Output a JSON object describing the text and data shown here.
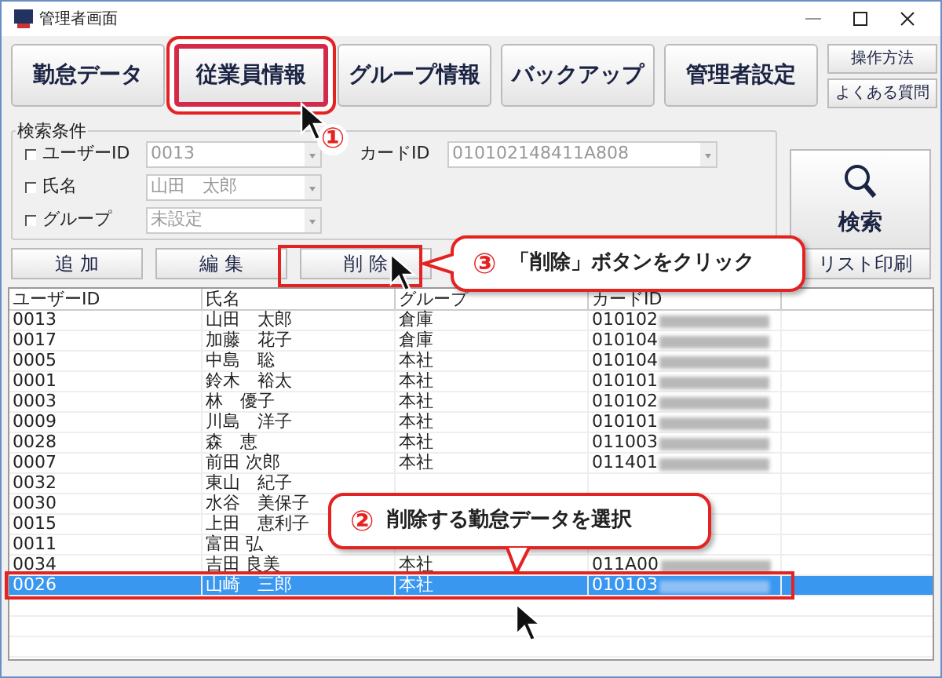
{
  "window": {
    "title": "管理者画面"
  },
  "tabs": [
    {
      "label": "勤怠データ",
      "selected": false
    },
    {
      "label": "従業員情報",
      "selected": true
    },
    {
      "label": "グループ情報",
      "selected": false
    },
    {
      "label": "バックアップ",
      "selected": false
    },
    {
      "label": "管理者設定",
      "selected": false
    }
  ],
  "help_buttons": [
    "操作方法",
    "よくある質問"
  ],
  "search": {
    "title": "検索条件",
    "button": "検索",
    "fields": [
      {
        "label": "ユーザーID",
        "checked": false,
        "value": "0013"
      },
      {
        "label": "氏名",
        "checked": false,
        "value": "山田　太郎"
      },
      {
        "label": "グループ",
        "checked": false,
        "value": "未設定"
      }
    ],
    "card_field": {
      "label": "カードID",
      "value": "010102148411A808"
    }
  },
  "actions": [
    "追 加",
    "編 集",
    "削 除",
    "リスト印刷"
  ],
  "table": {
    "columns": [
      "ユーザーID",
      "氏名",
      "グループ",
      "カードID"
    ],
    "rows": [
      {
        "cells": [
          "0013",
          "山田　太郎",
          "倉庫",
          "010102"
        ],
        "selected": false
      },
      {
        "cells": [
          "0017",
          "加藤　花子",
          "倉庫",
          "010104"
        ],
        "selected": false
      },
      {
        "cells": [
          "0005",
          "中島　聡",
          "本社",
          "010104"
        ],
        "selected": false
      },
      {
        "cells": [
          "0001",
          "鈴木　裕太",
          "本社",
          "010101"
        ],
        "selected": false
      },
      {
        "cells": [
          "0003",
          "林　優子",
          "本社",
          "010102"
        ],
        "selected": false
      },
      {
        "cells": [
          "0009",
          "川島　洋子",
          "本社",
          "010101"
        ],
        "selected": false
      },
      {
        "cells": [
          "0028",
          "森　恵",
          "本社",
          "011003"
        ],
        "selected": false
      },
      {
        "cells": [
          "0007",
          "前田 次郎",
          "本社",
          "011401"
        ],
        "selected": false
      },
      {
        "cells": [
          "0032",
          "東山　紀子",
          "",
          ""
        ],
        "selected": false
      },
      {
        "cells": [
          "0030",
          "水谷　美保子",
          "",
          ""
        ],
        "selected": false
      },
      {
        "cells": [
          "0015",
          "上田　恵利子",
          "",
          ""
        ],
        "selected": false
      },
      {
        "cells": [
          "0011",
          "富田 弘",
          "",
          ""
        ],
        "selected": false
      },
      {
        "cells": [
          "0034",
          "吉田 良美",
          "本社",
          "011A00"
        ],
        "selected": false
      },
      {
        "cells": [
          "0026",
          "山崎　三郎",
          "本社",
          "010103"
        ],
        "selected": true
      }
    ]
  },
  "callouts": [
    {
      "number": "①"
    },
    {
      "number": "③",
      "text": "「削除」ボタンをクリック"
    },
    {
      "number": "②",
      "text": "削除する勤怠データを選択"
    }
  ]
}
